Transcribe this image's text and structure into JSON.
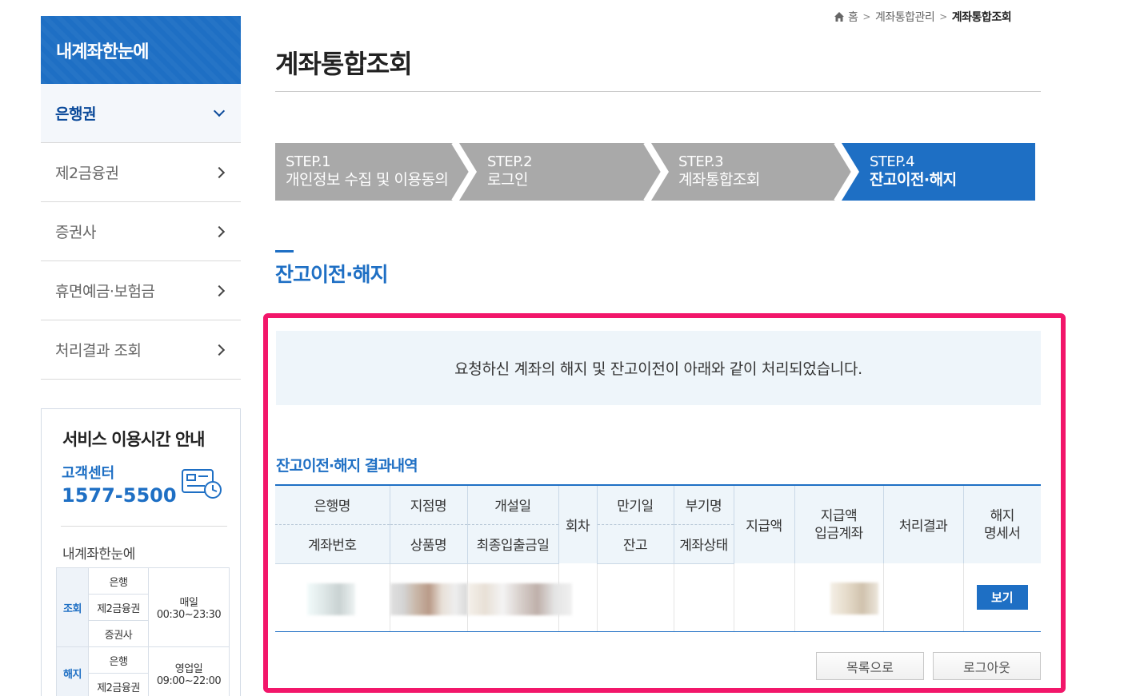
{
  "sidebar": {
    "title": "내계좌한눈에",
    "items": [
      {
        "label": "은행권",
        "active": true
      },
      {
        "label": "제2금융권",
        "active": false
      },
      {
        "label": "증권사",
        "active": false
      },
      {
        "label": "휴면예금·보험금",
        "active": false
      },
      {
        "label": "처리결과 조회",
        "active": false
      }
    ]
  },
  "service_info": {
    "title": "서비스 이용시간 안내",
    "cc_label": "고객센터",
    "cc_phone": "1577-5500",
    "subtitle": "내계좌한눈에",
    "rows": {
      "inquiry": {
        "category": "조회",
        "kinds": [
          "은행",
          "제2금융권",
          "증권사"
        ],
        "day": "매일",
        "time": "00:30~23:30"
      },
      "close": {
        "category": "해지",
        "kinds": [
          "은행",
          "제2금융권"
        ],
        "day": "영업일",
        "time": "09:00~22:00"
      }
    }
  },
  "breadcrumb": {
    "home": "홈",
    "parent": "계좌통합관리",
    "current": "계좌통합조회"
  },
  "page_title": "계좌통합조회",
  "steps": [
    {
      "label": "STEP.1",
      "desc": "개인정보 수집 및 이용동의",
      "active": false
    },
    {
      "label": "STEP.2",
      "desc": "로그인",
      "active": false
    },
    {
      "label": "STEP.3",
      "desc": "계좌통합조회",
      "active": false
    },
    {
      "label": "STEP.4",
      "desc": "잔고이전·해지",
      "active": true
    }
  ],
  "section_title": "잔고이전·해지",
  "notice": "요청하신 계좌의 해지 및 잔고이전이 아래와 같이 처리되었습니다.",
  "result": {
    "title": "잔고이전·해지 결과내역",
    "headers": {
      "bank": "은행명",
      "account_no": "계좌번호",
      "branch": "지점명",
      "product": "상품명",
      "open_date": "개설일",
      "last_txn": "최종입출금일",
      "round": "회차",
      "maturity": "만기일",
      "balance": "잔고",
      "sub_name": "부기명",
      "status": "계좌상태",
      "payout": "지급액",
      "payout_amount": "지급액",
      "deposit_account": "입금계좌",
      "result": "처리결과",
      "cert_1": "해지",
      "cert_2": "명세서"
    },
    "view_button": "보기"
  },
  "buttons": {
    "list": "목록으로",
    "logout": "로그아웃"
  },
  "colors": {
    "primary": "#1e6fc4",
    "step_inactive": "#a9a9a9",
    "highlight": "#f2166a",
    "notice_bg": "#eef5fa"
  }
}
